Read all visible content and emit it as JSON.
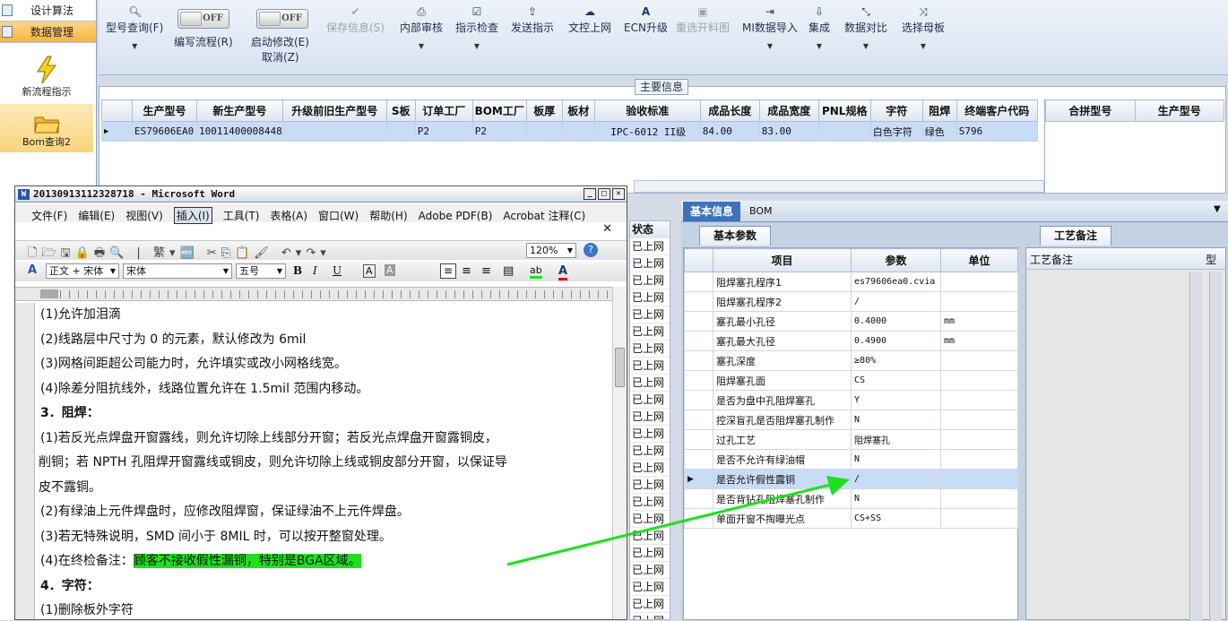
{
  "nav": {
    "items": [
      {
        "label": "设计算法"
      },
      {
        "label": "数据管理"
      }
    ],
    "tiles": [
      {
        "label": "新流程指示"
      },
      {
        "label": "Bom查询2"
      }
    ]
  },
  "toolbar": {
    "model_query": "型号查询(F)",
    "edit_flow": "编写流程(R)",
    "start_modify": "启动修改(E)",
    "cancel": "取消(Z)",
    "toggle_off": "OFF",
    "save_info": "保存信息(S)",
    "internal_review": "内部审核",
    "instruction_check": "指示检查",
    "send_instruction": "发送指示",
    "file_upload": "文控上网",
    "ecn_upgrade": "ECN升级",
    "reselect_image": "重选开料图",
    "mi_import": "MI数据导入",
    "integrate": "集成",
    "data_compare": "数据对比",
    "select_mother": "选择母板"
  },
  "main_info": {
    "title": "主要信息",
    "headers": [
      "生产型号",
      "新生产型号",
      "升级前旧生产型号",
      "S板",
      "订单工厂",
      "BOM工厂",
      "板厚",
      "板材",
      "验收标准",
      "成品长度",
      "成品宽度",
      "PNL规格",
      "字符",
      "阻焊",
      "终端客户代码"
    ],
    "row": [
      "ES79606EA0",
      "10011400008448",
      "",
      "",
      "P2",
      "P2",
      "",
      "",
      "IPC-6012 II级",
      "84.00",
      "83.00",
      "",
      "白色字符",
      "绿色",
      "S796"
    ],
    "side_headers": [
      "合拼型号",
      "生产型号"
    ]
  },
  "right_panel": {
    "tab_basic": "基本信息",
    "tab_bom": "BOM",
    "subtab_params": "基本参数",
    "subtab_craft": "工艺备注",
    "craft_header": "工艺备注",
    "craft_header2": "型",
    "param_headers": [
      "项目",
      "参数",
      "单位"
    ],
    "params": [
      {
        "item": "阻焊塞孔程序1",
        "value": "es79606ea0.cvia",
        "unit": ""
      },
      {
        "item": "阻焊塞孔程序2",
        "value": "/",
        "unit": ""
      },
      {
        "item": "塞孔最小孔径",
        "value": "0.4000",
        "unit": "mm"
      },
      {
        "item": "塞孔最大孔径",
        "value": "0.4900",
        "unit": "mm"
      },
      {
        "item": "塞孔深度",
        "value": "≥80%",
        "unit": ""
      },
      {
        "item": "阻焊塞孔面",
        "value": "CS",
        "unit": ""
      },
      {
        "item": "是否为盘中孔阻焊塞孔",
        "value": "Y",
        "unit": ""
      },
      {
        "item": "控深盲孔是否阻焊塞孔制作",
        "value": "N",
        "unit": ""
      },
      {
        "item": "过孔工艺",
        "value": "阻焊塞孔",
        "unit": ""
      },
      {
        "item": "是否不允许有绿油帽",
        "value": "N",
        "unit": ""
      },
      {
        "item": "是否允许假性露铜",
        "value": "/",
        "unit": ""
      },
      {
        "item": "是否背钻孔阻焊塞孔制作",
        "value": "N",
        "unit": ""
      },
      {
        "item": "单面开窗不掏曝光点",
        "value": "CS+SS",
        "unit": ""
      }
    ]
  },
  "status_column": {
    "header": "状态",
    "value": "已上网"
  },
  "word": {
    "title": "20130913112328718 - Microsoft Word",
    "menu": [
      "文件(F)",
      "编辑(E)",
      "视图(V)",
      "插入(I)",
      "工具(T)",
      "表格(A)",
      "窗口(W)",
      "帮助(H)",
      "Adobe PDF(B)",
      "Acrobat 注释(C)"
    ],
    "style": "正文 + 宋体",
    "font": "宋体",
    "size": "五号",
    "zoom": "120%",
    "lines": [
      "(1)允许加泪滴",
      "(2)线路层中尺寸为 0 的元素，默认修改为 6mil",
      "(3)网格间距超公司能力时，允许填实或改小网格线宽。",
      "(4)除差分阻抗线外，线路位置允许在 1.5mil 范围内移动。",
      "3．阻焊：",
      "(1)若反光点焊盘开窗露线，则允许切除上线部分开窗；若反光点焊盘开窗露铜皮，",
      "削铜；若 NPTH 孔阻焊开窗露线或铜皮，则允许切除上线或铜皮部分开窗，以保证导",
      "皮不露铜。",
      "(2)有绿油上元件焊盘时，应修改阻焊窗，保证绿油不上元件焊盘。",
      "(3)若无特殊说明，SMD 间小于 8MIL 时，可以按开整窗处理。",
      "(4)在终检备注：",
      "4．字符：",
      "(1)删除板外字符"
    ],
    "highlight": "顾客不接收假性漏铜，特别是BGA区域。"
  }
}
